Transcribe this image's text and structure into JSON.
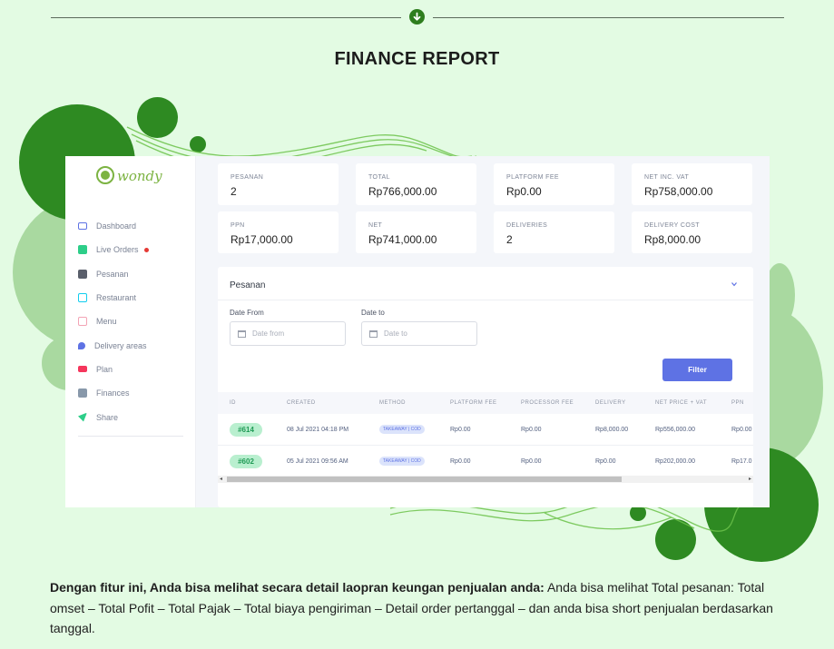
{
  "title": "FINANCE REPORT",
  "divider_icon": "arrow-down-icon",
  "colors": {
    "background": "#e3fbe3",
    "green": "#2e7d1e",
    "accent": "#5e72e4"
  },
  "sidebar": {
    "logo_text": "wondy",
    "items": [
      {
        "label": "Dashboard",
        "icon": "monitor-icon"
      },
      {
        "label": "Live Orders",
        "icon": "calendar-icon",
        "live_dot": true
      },
      {
        "label": "Pesanan",
        "icon": "basket-icon"
      },
      {
        "label": "Restaurant",
        "icon": "store-icon"
      },
      {
        "label": "Menu",
        "icon": "menu-icon"
      },
      {
        "label": "Delivery areas",
        "icon": "map-pin-icon"
      },
      {
        "label": "Plan",
        "icon": "credit-card-icon"
      },
      {
        "label": "Finances",
        "icon": "finance-icon"
      },
      {
        "label": "Share",
        "icon": "send-icon"
      }
    ]
  },
  "stats": [
    {
      "label": "PESANAN",
      "value": "2"
    },
    {
      "label": "TOTAL",
      "value": "Rp766,000.00"
    },
    {
      "label": "PLATFORM FEE",
      "value": "Rp0.00"
    },
    {
      "label": "NET INC. VAT",
      "value": "Rp758,000.00"
    },
    {
      "label": "PPN",
      "value": "Rp17,000.00"
    },
    {
      "label": "NET",
      "value": "Rp741,000.00"
    },
    {
      "label": "DELIVERIES",
      "value": "2"
    },
    {
      "label": "DELIVERY COST",
      "value": "Rp8,000.00"
    }
  ],
  "panel": {
    "title": "Pesanan",
    "date_from_label": "Date From",
    "date_from_placeholder": "Date from",
    "date_to_label": "Date to",
    "date_to_placeholder": "Date to",
    "filter_label": "Filter"
  },
  "table": {
    "columns": [
      "ID",
      "CREATED",
      "METHOD",
      "PLATFORM FEE",
      "PROCESSOR FEE",
      "DELIVERY",
      "NET PRICE + VAT",
      "PPN"
    ],
    "rows": [
      {
        "id": "#614",
        "created": "08 Jul 2021 04:18 PM",
        "method": "TAKEAWAY | COD",
        "platform_fee": "Rp0.00",
        "processor_fee": "Rp0.00",
        "delivery": "Rp8,000.00",
        "net_price": "Rp556,000.00",
        "ppn": "Rp0.00"
      },
      {
        "id": "#602",
        "created": "05 Jul 2021 09:56 AM",
        "method": "TAKEAWAY | COD",
        "platform_fee": "Rp0.00",
        "processor_fee": "Rp0.00",
        "delivery": "Rp0.00",
        "net_price": "Rp202,000.00",
        "ppn": "Rp17.0"
      }
    ]
  },
  "description": {
    "bold": "Dengan fitur ini, Anda bisa melihat secara detail laopran keungan penjualan anda:",
    "text": " Anda bisa melihat Total pesanan: Total omset – Total Pofit – Total Pajak – Total biaya pengiriman – Detail order pertanggal – dan anda bisa short penjualan berdasarkan tanggal."
  }
}
